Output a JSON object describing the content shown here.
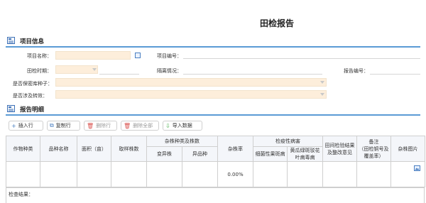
{
  "page": {
    "title": "田检报告"
  },
  "sections": {
    "project_info": "项目信息",
    "report_detail": "报告明细"
  },
  "form": {
    "project_name_label": "项目名称：",
    "project_no_label": "项目编号：",
    "inspection_period_label": "田检时期：",
    "isolation_label": "隔离情况：",
    "report_no_label": "报告编号：",
    "seed_bank_label": "是否保密库种子：",
    "transgenic_label": "是否涉及转效："
  },
  "toolbar": {
    "insert_row": "插入行",
    "copy_row": "复制行",
    "delete_row": "删除行",
    "delete_all": "删除全部",
    "import_data": "导入数据"
  },
  "table": {
    "headers": {
      "crop_type": "作物种类",
      "variety_name": "品种名称",
      "area": "面积（亩）",
      "sample_count": "取样株数",
      "hybrid_group": "杂株种类及株数",
      "mutant": "变异株",
      "offtype": "异品种",
      "hybrid_rate": "杂株率",
      "quarantine_group": "检疫性病害",
      "bacterial_blotch": "细菌性果斑病",
      "cucumber_mottle_1": "黄瓜绿斑驳花",
      "cucumber_mottle_2": "叶病毒病",
      "field_result_1": "田间检验结果",
      "field_result_2": "及整改意见",
      "remark_1": "备注",
      "remark_2": "（田检铜号及",
      "remark_3": "覆盖率）",
      "hybrid_photo": "杂株图片"
    },
    "rows": [
      {
        "hybrid_rate": "0.00%"
      }
    ]
  },
  "result": {
    "label": "检查结果："
  },
  "colors": {
    "accent": "#5b9bd5",
    "required_field": "#fdeedb"
  }
}
